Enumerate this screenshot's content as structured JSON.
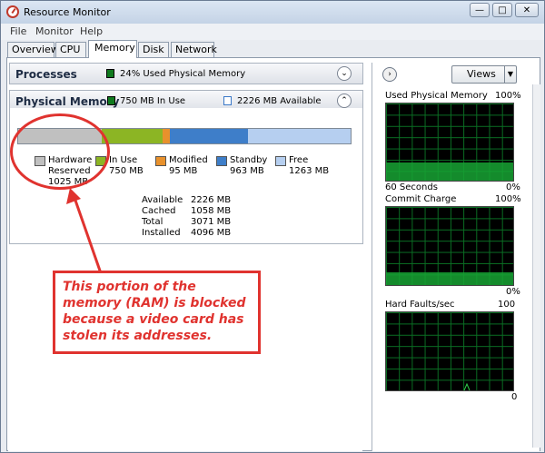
{
  "window": {
    "title": "Resource Monitor",
    "min_icon": "minimize-icon",
    "max_icon": "maximize-icon",
    "close_icon": "close-icon"
  },
  "menu": [
    "File",
    "Monitor",
    "Help"
  ],
  "tabs": [
    "Overview",
    "CPU",
    "Memory",
    "Disk",
    "Network"
  ],
  "active_tab": "Memory",
  "processes": {
    "title": "Processes",
    "legend_text": "24% Used Physical Memory",
    "legend_color": "#0f7a1e"
  },
  "physical_memory": {
    "title": "Physical Memory",
    "in_use_text": "750 MB In Use",
    "available_text": "2226 MB Available",
    "in_use_color": "#0f7a1e",
    "available_color": "#3a78c8",
    "bar": [
      {
        "name": "hardware-reserved",
        "value": 1025,
        "color": "#c0c0c0"
      },
      {
        "name": "in-use",
        "value": 750,
        "color": "#8cb524"
      },
      {
        "name": "modified",
        "value": 95,
        "color": "#e8912c"
      },
      {
        "name": "standby",
        "value": 963,
        "color": "#3e7ec9"
      },
      {
        "name": "free",
        "value": 1263,
        "color": "#b6cff0"
      }
    ],
    "legend": [
      {
        "label": "Hardware Reserved",
        "label_line1": "Hardware",
        "label_line2": "Reserved",
        "value": "1025 MB",
        "color": "#c0c0c0"
      },
      {
        "label": "In Use",
        "value": "750 MB",
        "color": "#8cb524"
      },
      {
        "label": "Modified",
        "value": "95 MB",
        "color": "#e8912c"
      },
      {
        "label": "Standby",
        "value": "963 MB",
        "color": "#3e7ec9"
      },
      {
        "label": "Free",
        "value": "1263 MB",
        "color": "#b6cff0"
      }
    ],
    "stats": [
      {
        "label": "Available",
        "value": "2226 MB"
      },
      {
        "label": "Cached",
        "value": "1058 MB"
      },
      {
        "label": "Total",
        "value": "3071 MB"
      },
      {
        "label": "Installed",
        "value": "4096 MB"
      }
    ]
  },
  "right_panel": {
    "views_label": "Views",
    "graphs": [
      {
        "title": "Used Physical Memory",
        "max": "100%",
        "bottom_left": "60 Seconds",
        "min": "0%"
      },
      {
        "title": "Commit Charge",
        "max": "100%",
        "bottom_left": "",
        "min": "0%"
      },
      {
        "title": "Hard Faults/sec",
        "max": "100",
        "bottom_left": "",
        "min": "0"
      }
    ]
  },
  "annotation": {
    "text": "This portion of the memory (RAM) is blocked because a video card has stolen its addresses.",
    "color": "#e0332f"
  }
}
